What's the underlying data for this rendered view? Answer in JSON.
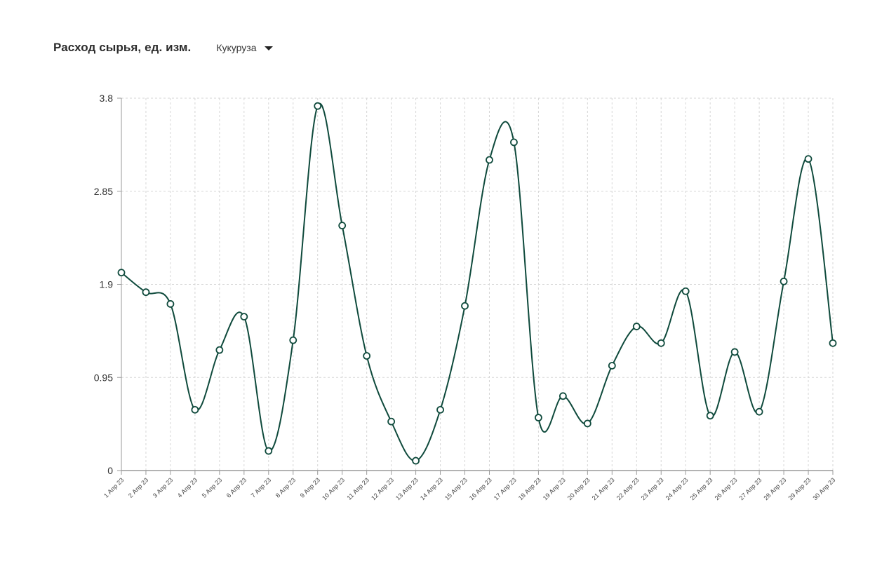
{
  "header": {
    "title": "Расход сырья, ед. изм.",
    "selector_value": "Кукуруза"
  },
  "colors": {
    "line": "#0f4a3c",
    "marker_fill": "#ffffff",
    "grid": "#d6d6d6",
    "axis": "#9a9a9a"
  },
  "chart_data": {
    "type": "line",
    "title": "Расход сырья, ед. изм.",
    "xlabel": "",
    "ylabel": "",
    "ylim": [
      0,
      3.8
    ],
    "yticks": [
      "0",
      "0.95",
      "1.9",
      "2.85",
      "3.8"
    ],
    "ytick_values": [
      0,
      0.95,
      1.9,
      2.85,
      3.8
    ],
    "grid": true,
    "categories": [
      "1 Апр 23",
      "2 Апр 23",
      "3 Апр 23",
      "4 Апр 23",
      "5 Апр 23",
      "6 Апр 23",
      "7 Апр 23",
      "8 Апр 23",
      "9 Апр 23",
      "10 Апр 23",
      "11 Апр 23",
      "12 Апр 23",
      "13 Апр 23",
      "14 Апр 23",
      "15 Апр 23",
      "16 Апр 23",
      "17 Апр 23",
      "18 Апр 23",
      "19 Апр 23",
      "20 Апр 23",
      "21 Апр 23",
      "22 Апр 23",
      "23 Апр 23",
      "24 Апр 23",
      "25 Апр 23",
      "26 Апр 23",
      "27 Апр 23",
      "28 Апр 23",
      "29 Апр 23",
      "30 Апр 23"
    ],
    "series": [
      {
        "values": [
          2.02,
          1.82,
          1.7,
          0.62,
          1.23,
          1.57,
          0.2,
          1.33,
          3.72,
          2.5,
          1.17,
          0.5,
          0.1,
          0.62,
          1.68,
          3.17,
          3.35,
          0.54,
          0.76,
          0.48,
          1.07,
          1.47,
          1.3,
          1.83,
          0.56,
          1.21,
          0.6,
          1.93,
          3.18,
          1.3
        ]
      }
    ]
  }
}
